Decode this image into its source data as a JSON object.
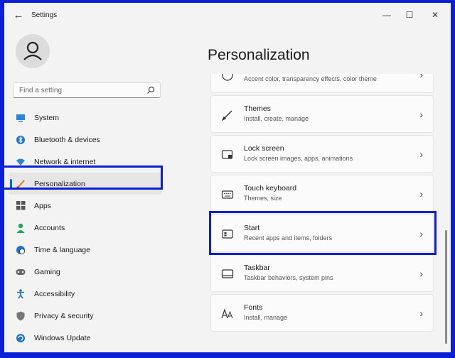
{
  "window": {
    "title": "Settings"
  },
  "search": {
    "placeholder": "Find a setting"
  },
  "nav": [
    {
      "label": "System",
      "icon": "monitor-icon",
      "active": false
    },
    {
      "label": "Bluetooth & devices",
      "icon": "bluetooth-icon",
      "active": false
    },
    {
      "label": "Network & internet",
      "icon": "wifi-icon",
      "active": false
    },
    {
      "label": "Personalization",
      "icon": "brush-icon",
      "active": true
    },
    {
      "label": "Apps",
      "icon": "apps-icon",
      "active": false
    },
    {
      "label": "Accounts",
      "icon": "person-icon",
      "active": false
    },
    {
      "label": "Time & language",
      "icon": "globe-clock-icon",
      "active": false
    },
    {
      "label": "Gaming",
      "icon": "gamepad-icon",
      "active": false
    },
    {
      "label": "Accessibility",
      "icon": "accessibility-icon",
      "active": false
    },
    {
      "label": "Privacy & security",
      "icon": "shield-icon",
      "active": false
    },
    {
      "label": "Windows Update",
      "icon": "update-icon",
      "active": false
    }
  ],
  "page": {
    "title": "Personalization"
  },
  "cards": [
    {
      "title": "",
      "subtitle": "Accent color, transparency effects, color theme",
      "icon": "palette-icon"
    },
    {
      "title": "Themes",
      "subtitle": "Install, create, manage",
      "icon": "brush-icon"
    },
    {
      "title": "Lock screen",
      "subtitle": "Lock screen images, apps, animations",
      "icon": "lock-screen-icon"
    },
    {
      "title": "Touch keyboard",
      "subtitle": "Themes, size",
      "icon": "keyboard-icon"
    },
    {
      "title": "Start",
      "subtitle": "Recent apps and items, folders",
      "icon": "start-icon"
    },
    {
      "title": "Taskbar",
      "subtitle": "Taskbar behaviors, system pins",
      "icon": "taskbar-icon"
    },
    {
      "title": "Fonts",
      "subtitle": "Install, manage",
      "icon": "fonts-icon"
    }
  ],
  "colors": {
    "highlight": "#0a1fd6",
    "accent": "#0a67c2",
    "background": "#f3f3f3"
  }
}
